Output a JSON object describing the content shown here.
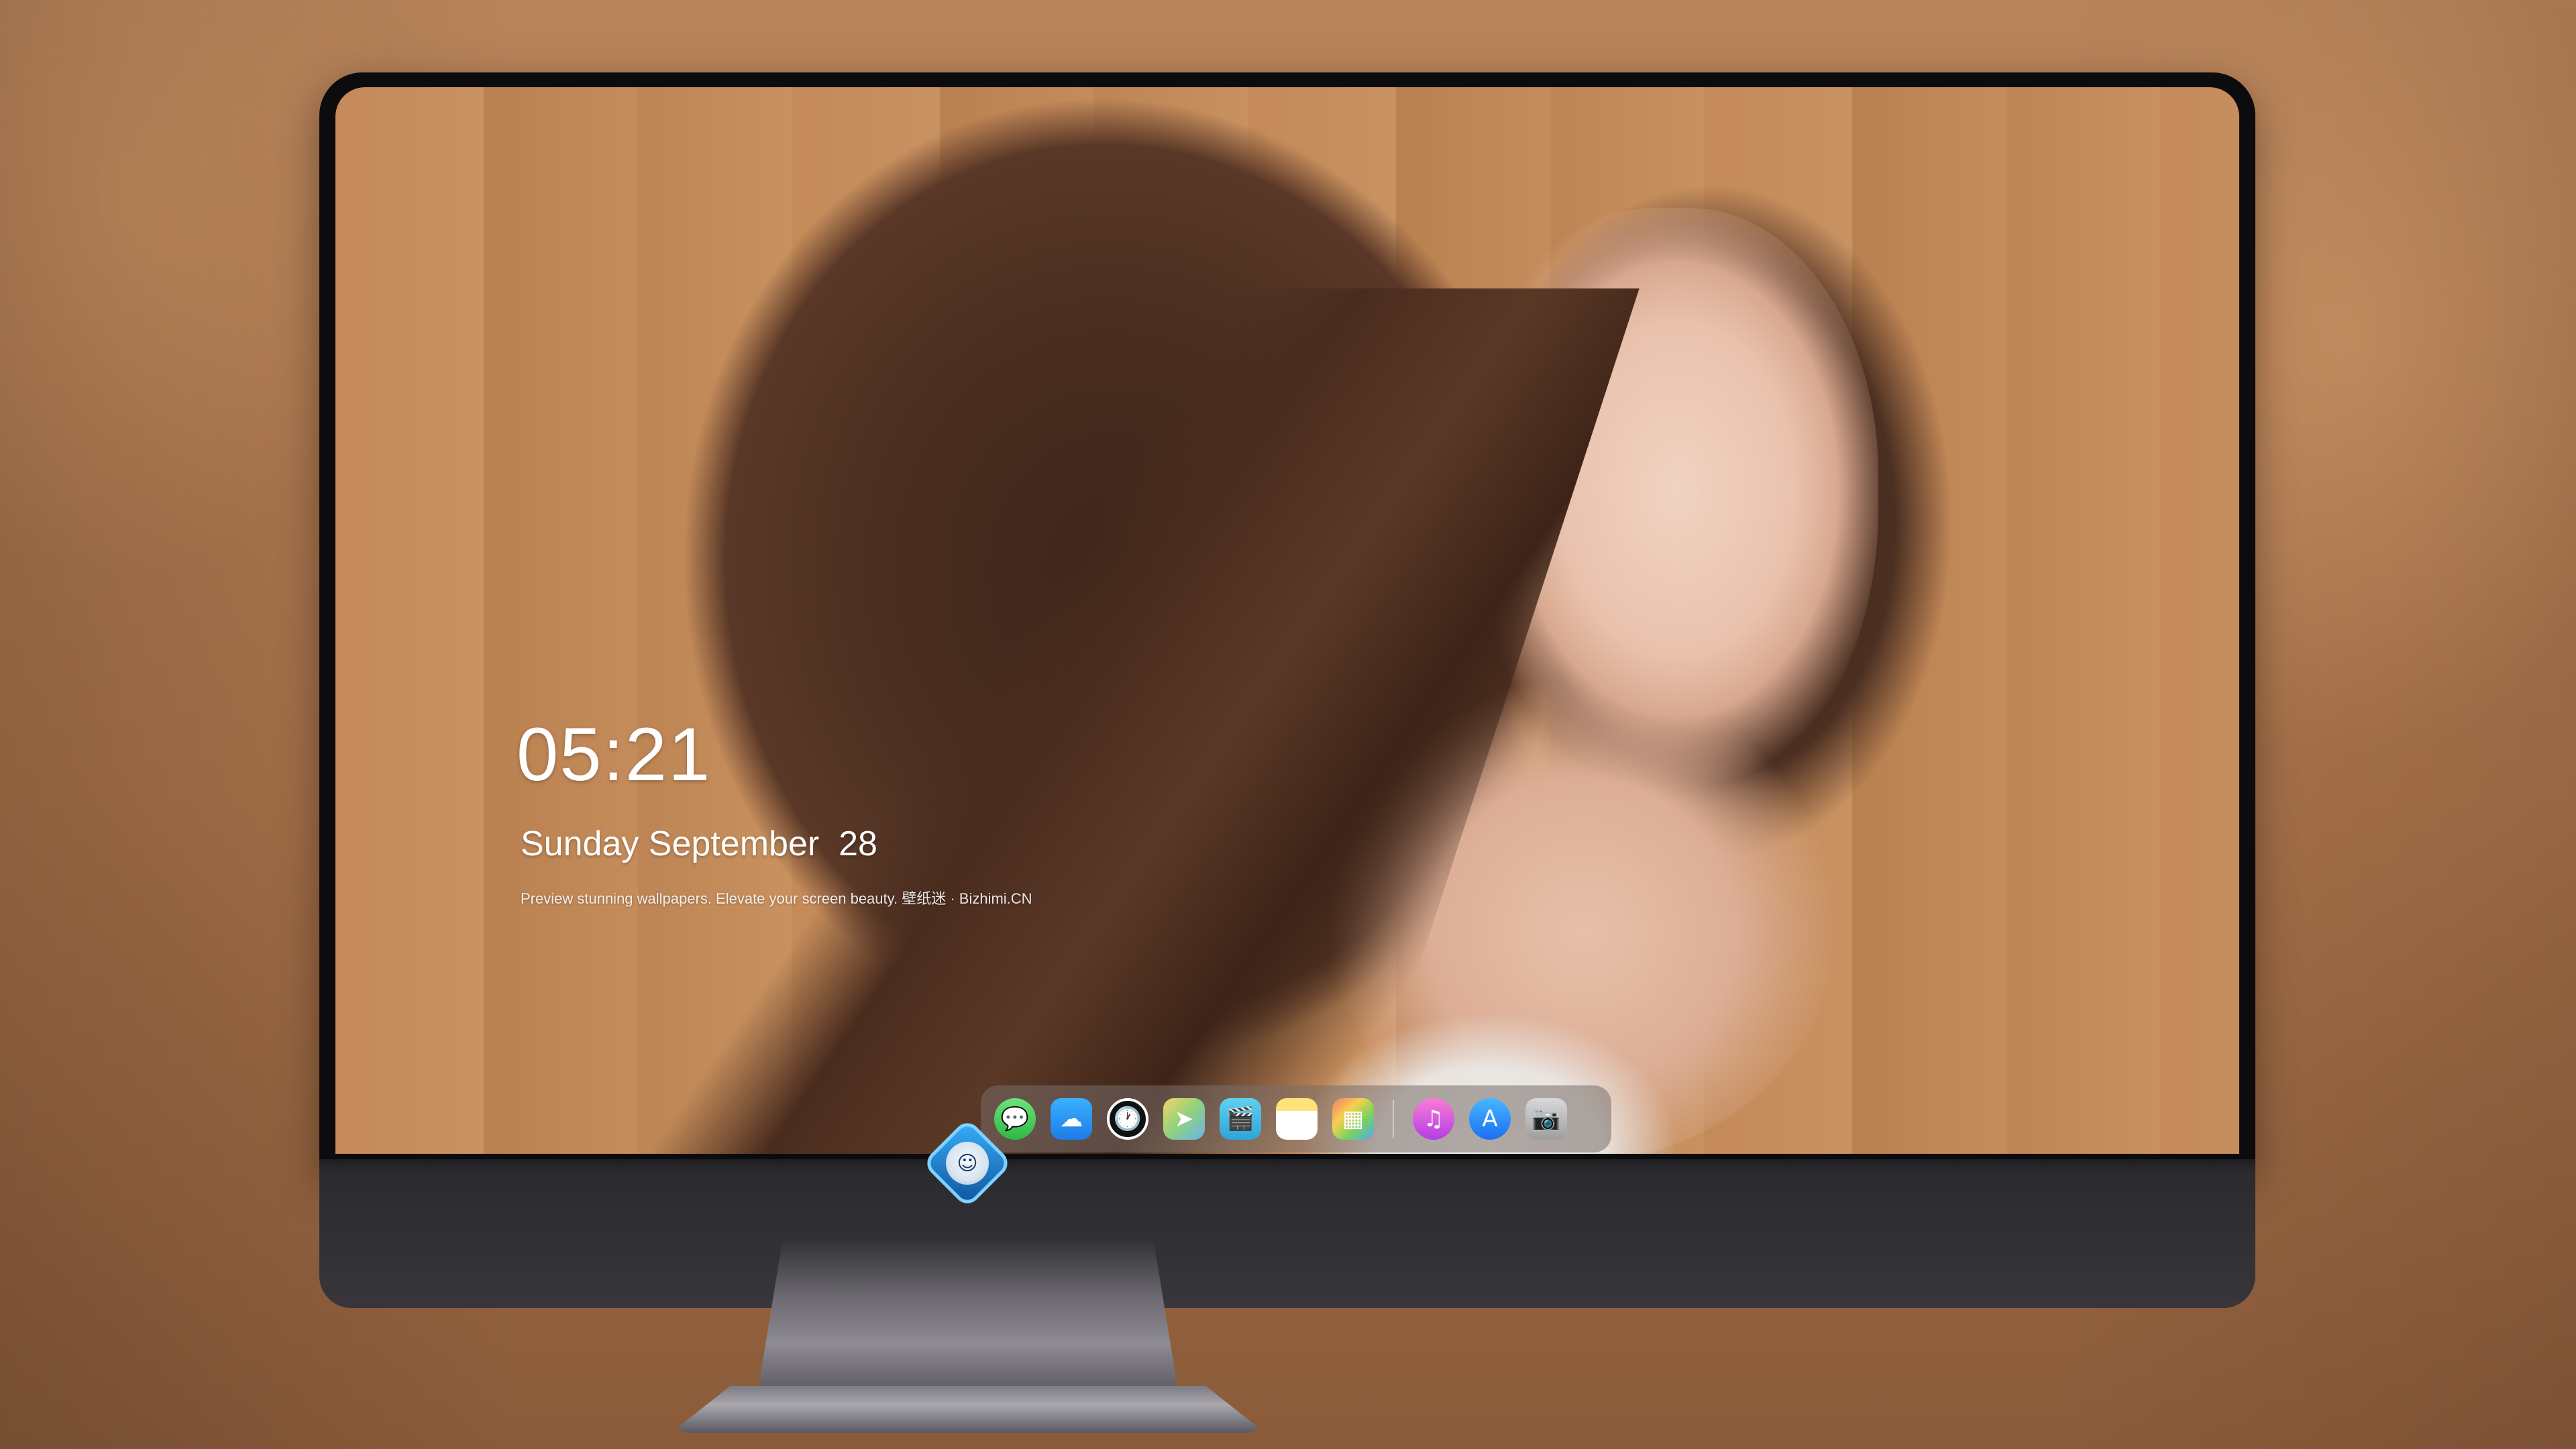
{
  "lockscreen": {
    "time": "05:21",
    "date": "Sunday September  28",
    "tagline": "Preview stunning wallpapers. Elevate your screen beauty. 壁纸迷 · Bizhimi.CN"
  },
  "dock": {
    "apps": [
      {
        "name": "Messages",
        "icon": "messages-icon",
        "glyph": "💬"
      },
      {
        "name": "Weather",
        "icon": "weather-icon",
        "glyph": "☁"
      },
      {
        "name": "Clock",
        "icon": "clock-icon",
        "glyph": "🕐"
      },
      {
        "name": "Maps",
        "icon": "maps-icon",
        "glyph": "➤"
      },
      {
        "name": "Videos",
        "icon": "video-icon",
        "glyph": "🎬"
      },
      {
        "name": "Notes",
        "icon": "notes-icon",
        "glyph": ""
      },
      {
        "name": "Photos",
        "icon": "photos-icon",
        "glyph": "▦"
      },
      {
        "name": "Music",
        "icon": "music-icon",
        "glyph": "♫"
      },
      {
        "name": "App Store",
        "icon": "app-store-icon",
        "glyph": "A"
      },
      {
        "name": "Camera",
        "icon": "camera-icon",
        "glyph": "📷"
      }
    ]
  },
  "chin": {
    "logo": "bizhimi-logo-icon"
  },
  "colors": {
    "background": "#b07a4f",
    "bezel": "#0c0c0e",
    "chin": "#38363a",
    "dock": "#786e69"
  }
}
